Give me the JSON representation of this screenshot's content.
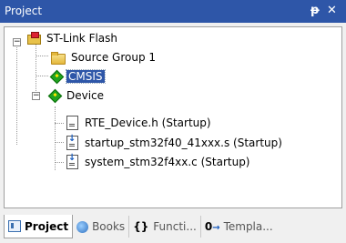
{
  "window": {
    "title": "Project",
    "pin_glyph": "ᵽ",
    "close_glyph": "✕"
  },
  "tree": {
    "root": {
      "label": "ST-Link Flash",
      "expander": "−",
      "icon": "project-icon"
    },
    "items": [
      {
        "label": "Source Group 1",
        "icon": "folder-icon"
      },
      {
        "label": "CMSIS",
        "icon": "diamond-icon",
        "selected": true
      },
      {
        "label": "Device",
        "icon": "diamond-icon",
        "expander": "−"
      },
      {
        "label": "RTE_Device.h (Startup)",
        "icon": "file-icon"
      },
      {
        "label": "startup_stm32f40_41xxx.s (Startup)",
        "icon": "file-arrow-icon"
      },
      {
        "label": "system_stm32f4xx.c (Startup)",
        "icon": "file-arrow-icon"
      }
    ]
  },
  "tabs": [
    {
      "label": "Project",
      "icon": "project-tab-icon",
      "active": true
    },
    {
      "label": "Books",
      "icon": "books-icon"
    },
    {
      "label": "Functi...",
      "icon_text": "{}",
      "icon": "functions-icon"
    },
    {
      "label": "Templa...",
      "icon_text": "0",
      "icon": "templates-icon"
    }
  ]
}
